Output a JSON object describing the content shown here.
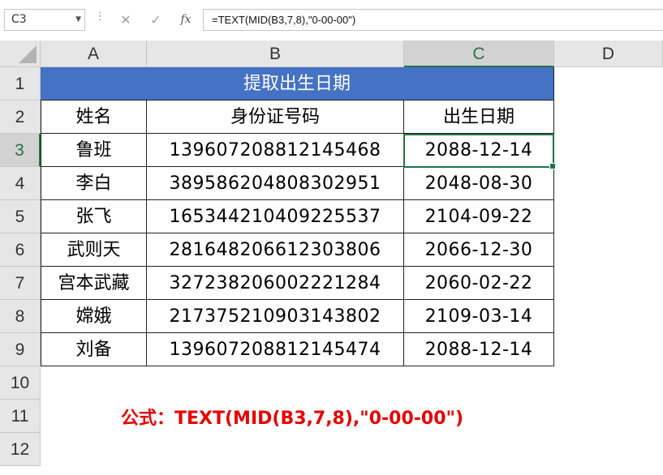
{
  "formula_bar": {
    "name_box": "C3",
    "cancel_icon": "✕",
    "enter_icon": "✓",
    "fx_label": "fx",
    "formula": "=TEXT(MID(B3,7,8),\"0-00-00\")"
  },
  "columns": [
    "A",
    "B",
    "C",
    "D"
  ],
  "rows": [
    "1",
    "2",
    "3",
    "4",
    "5",
    "6",
    "7",
    "8",
    "9",
    "10",
    "11",
    "12"
  ],
  "table": {
    "title": "提取出生日期",
    "headers": [
      "姓名",
      "身份证号码",
      "出生日期"
    ],
    "records": [
      {
        "name": "鲁班",
        "id": "139607208812145468",
        "birth": "2088-12-14"
      },
      {
        "name": "李白",
        "id": "389586204808302951",
        "birth": "2048-08-30"
      },
      {
        "name": "张飞",
        "id": "165344210409225537",
        "birth": "2104-09-22"
      },
      {
        "name": "武则天",
        "id": "281648206612303806",
        "birth": "2066-12-30"
      },
      {
        "name": "宫本武藏",
        "id": "327238206002221284",
        "birth": "2060-02-22"
      },
      {
        "name": "嫦娥",
        "id": "217375210903143802",
        "birth": "2109-03-14"
      },
      {
        "name": "刘备",
        "id": "139607208812145474",
        "birth": "2088-12-14"
      }
    ]
  },
  "note": "公式：TEXT(MID(B3,7,8),\"0-00-00\")",
  "colors": {
    "title_fill": "#4472c4",
    "selection": "#217346",
    "note_text": "#e60000"
  }
}
